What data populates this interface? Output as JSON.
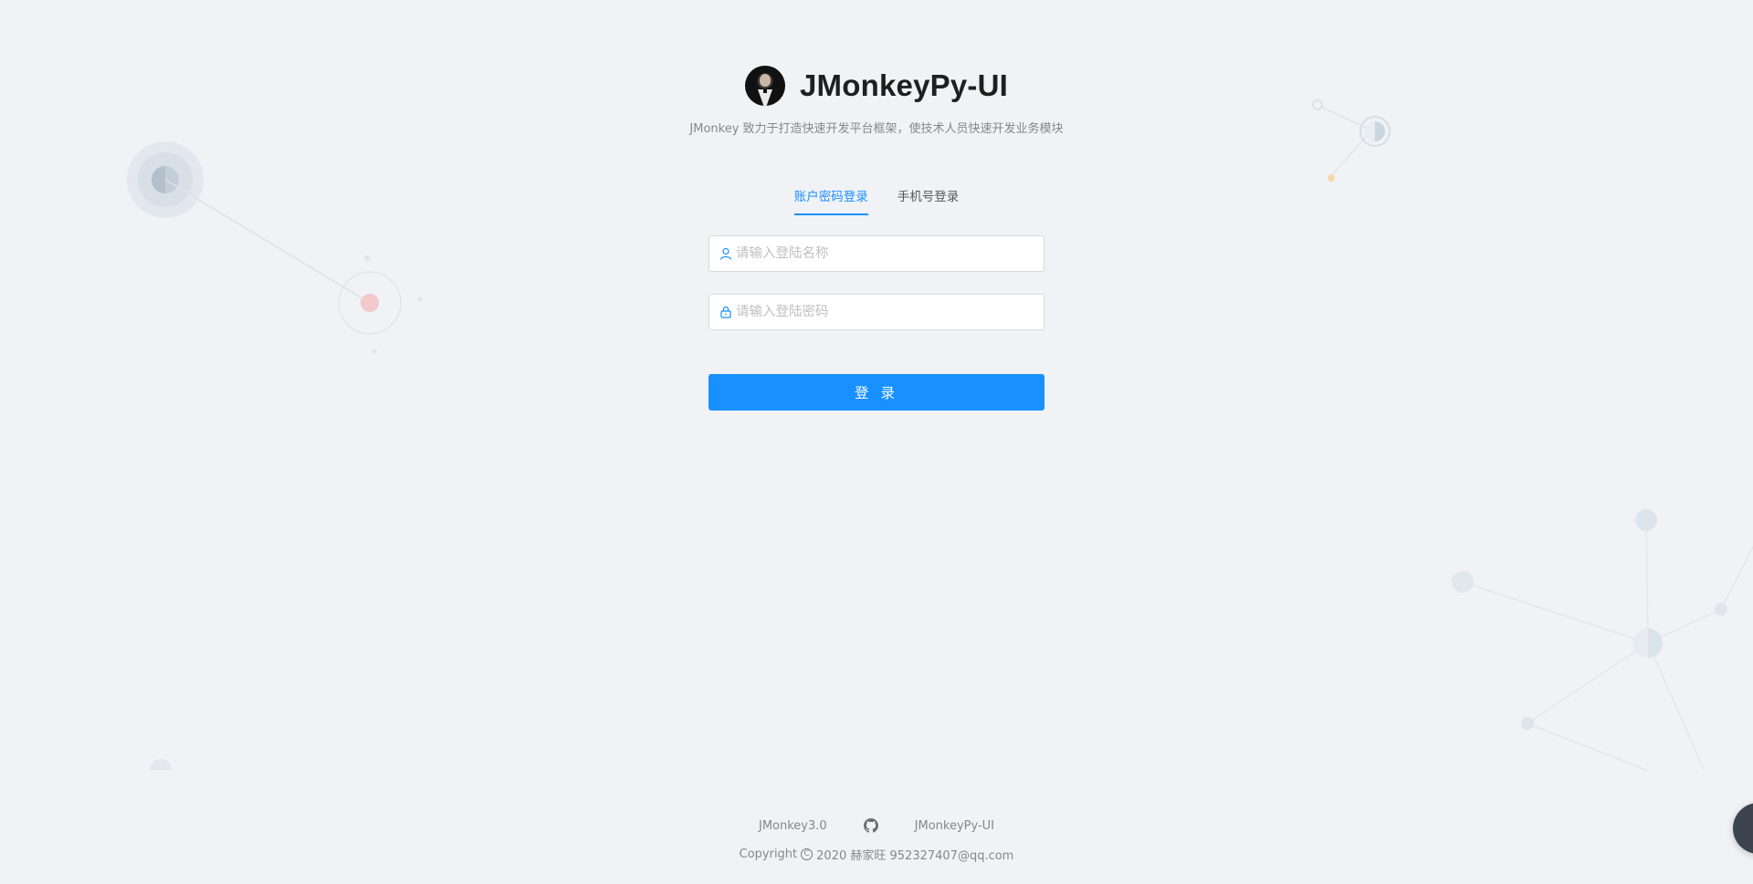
{
  "app": {
    "title": "JMonkeyPy-UI",
    "description": "JMonkey 致力于打造快速开发平台框架，使技术人员快速开发业务模块"
  },
  "tabs": [
    {
      "label": "账户密码登录",
      "active": true
    },
    {
      "label": "手机号登录",
      "active": false
    }
  ],
  "form": {
    "username_placeholder": "请输入登陆名称",
    "username_value": "",
    "password_placeholder": "请输入登陆密码",
    "password_value": "",
    "submit_label": "登 录"
  },
  "footer": {
    "links": [
      "JMonkey3.0",
      "JMonkeyPy-UI"
    ],
    "copyright_prefix": "Copyright",
    "copyright_suffix": "2020 赫家旺 952327407@qq.com"
  },
  "icons": {
    "user": "user-icon",
    "lock": "lock-icon",
    "github": "github-icon",
    "copyright": "copyright-icon"
  },
  "colors": {
    "accent": "#1890ff",
    "background": "#f0f2f5"
  }
}
